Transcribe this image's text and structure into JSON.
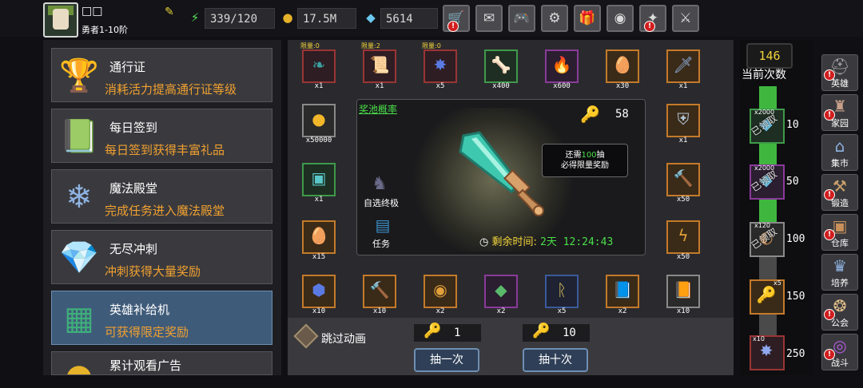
{
  "player": {
    "name": "□□",
    "title": "勇者1-10阶",
    "resources": {
      "energy": "339/120",
      "gold": "17.5M",
      "gems": "5614"
    }
  },
  "top_buttons": [
    "shop",
    "mail",
    "gamepad",
    "settings",
    "gift",
    "wheel",
    "cheer",
    "battle"
  ],
  "menu": [
    {
      "title": "通行证",
      "subtitle": "消耗活力提高通行证等级"
    },
    {
      "title": "每日签到",
      "subtitle": "每日签到获得丰富礼品"
    },
    {
      "title": "魔法殿堂",
      "subtitle": "完成任务进入魔法殿堂"
    },
    {
      "title": "无尽冲刺",
      "subtitle": "冲刺获得大量奖励"
    },
    {
      "title": "英雄补给机",
      "subtitle": "可获得限定奖励"
    },
    {
      "title": "累计观看广告",
      "subtitle": ""
    }
  ],
  "prize_slots_top": [
    {
      "limit": "限量:0",
      "count": "x1",
      "icon": "feather-icon"
    },
    {
      "limit": "限量:2",
      "count": "x1",
      "icon": "scroll-icon"
    },
    {
      "limit": "限量:0",
      "count": "x5",
      "icon": "crystal-icon"
    },
    {
      "limit": "",
      "count": "x400",
      "icon": "bone-icon"
    },
    {
      "limit": "",
      "count": "x600",
      "icon": "fire-icon"
    },
    {
      "limit": "",
      "count": "x30",
      "icon": "egg-icon"
    },
    {
      "limit": "",
      "count": "x1",
      "icon": "sword-icon"
    }
  ],
  "prize_slots_left": [
    {
      "count": "x50000",
      "icon": "coin-icon"
    },
    {
      "count": "x1",
      "icon": "chest-icon"
    },
    {
      "count": "x15",
      "icon": "egg-icon"
    }
  ],
  "prize_slots_right": [
    {
      "count": "x1",
      "icon": "shield-icon"
    },
    {
      "count": "x50",
      "icon": "hammer-icon"
    },
    {
      "count": "x50",
      "icon": "flame-icon"
    }
  ],
  "prize_slots_bottom": [
    {
      "count": "x10",
      "icon": "ore-icon"
    },
    {
      "count": "x10",
      "icon": "hammer-icon"
    },
    {
      "count": "x2",
      "icon": "medal-icon"
    },
    {
      "count": "x2",
      "icon": "gem-icon"
    },
    {
      "count": "x5",
      "icon": "rune-icon"
    },
    {
      "count": "x2",
      "icon": "book-icon"
    },
    {
      "count": "x10",
      "icon": "tome-icon"
    }
  ],
  "pool": {
    "link_label": "奖池概率",
    "key_count": "58",
    "tip_prefix": "还需",
    "tip_number": "100",
    "tip_suffix": "抽",
    "tip_line2": "必得限量奖励",
    "hero_label": "自选终极",
    "task_label": "任务",
    "timer_label": "剩余时间:",
    "timer_value": "2天 12:24:43"
  },
  "bottom": {
    "skip_label": "跳过动画",
    "cost_single": "1",
    "cost_ten": "10",
    "draw_once": "抽一次",
    "draw_ten": "抽十次"
  },
  "progress": {
    "count": "146",
    "count_label": "当前次数",
    "milestones": [
      {
        "value": "10",
        "reward": "x2000",
        "claimed_label": "已领取",
        "icon": "gem-icon"
      },
      {
        "value": "50",
        "reward": "x2000",
        "claimed_label": "已领取",
        "icon": "gem-icon"
      },
      {
        "value": "100",
        "reward": "x120",
        "claimed_label": "已领取",
        "icon": "shell-icon"
      },
      {
        "value": "150",
        "reward": "x5",
        "claimed_label": "",
        "icon": "key-icon"
      },
      {
        "value": "250",
        "reward": "x10",
        "claimed_label": "",
        "icon": "crystal-icon"
      }
    ]
  },
  "nav": [
    {
      "label": "英雄",
      "icon": "helmet-icon"
    },
    {
      "label": "家园",
      "icon": "castle-icon"
    },
    {
      "label": "集市",
      "icon": "market-icon"
    },
    {
      "label": "锻造",
      "icon": "anvil-icon"
    },
    {
      "label": "仓库",
      "icon": "chest-icon"
    },
    {
      "label": "培养",
      "icon": "trophy-icon"
    },
    {
      "label": "公会",
      "icon": "guild-icon"
    },
    {
      "label": "战斗",
      "icon": "portal-icon"
    }
  ],
  "colors": {
    "accent_orange": "#f0a030",
    "accent_green": "#4adf4a",
    "accent_yellow": "#f2d43a",
    "active_menu": "#3f5b7a"
  }
}
